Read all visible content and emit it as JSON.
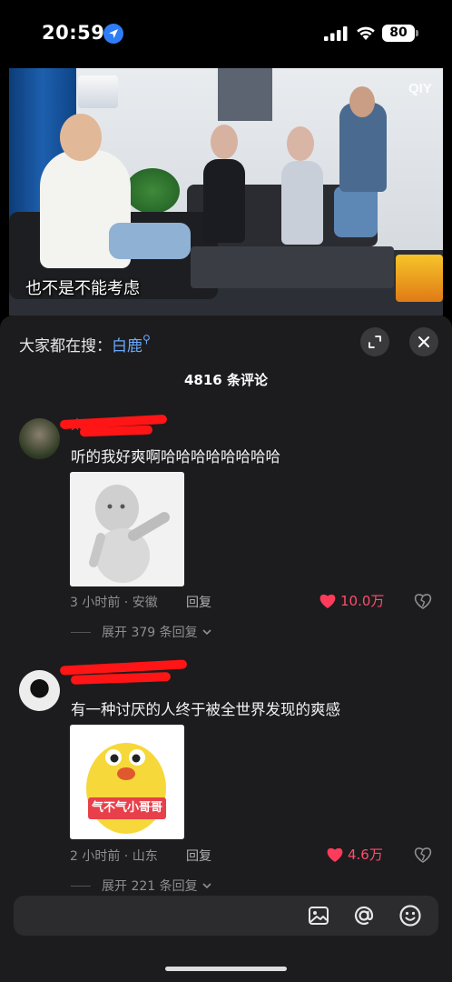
{
  "status_bar": {
    "time": "20:59",
    "battery": "80",
    "icons": [
      "location-icon",
      "signal-icon",
      "wifi-icon",
      "battery-icon"
    ]
  },
  "video": {
    "subtitle": "也不是不能考虑",
    "watermark": "QIY"
  },
  "sheet": {
    "search_prefix": "大家都在搜：",
    "search_keyword": "白鹿",
    "comment_count_label": "4816 条评论"
  },
  "comments": [
    {
      "username": "太...",
      "text": "听的我好爽啊哈哈哈哈哈哈哈哈",
      "time_location": "3 小时前 · 安徽",
      "reply_label": "回复",
      "likes": "10.0万",
      "expand_label": "展开 379 条回复"
    },
    {
      "username": "",
      "text": "有一种讨厌的人终于被全世界发现的爽感",
      "sticker_text": "气不气小哥哥",
      "time_location": "2 小时前 · 山东",
      "reply_label": "回复",
      "likes": "4.6万",
      "expand_label": "展开 221 条回复"
    }
  ],
  "input_bar": {
    "placeholder": ""
  },
  "colors": {
    "accent_blue": "#6aa9ff",
    "like_red": "#ff4d6a",
    "sheet_bg": "#1c1c1e"
  }
}
